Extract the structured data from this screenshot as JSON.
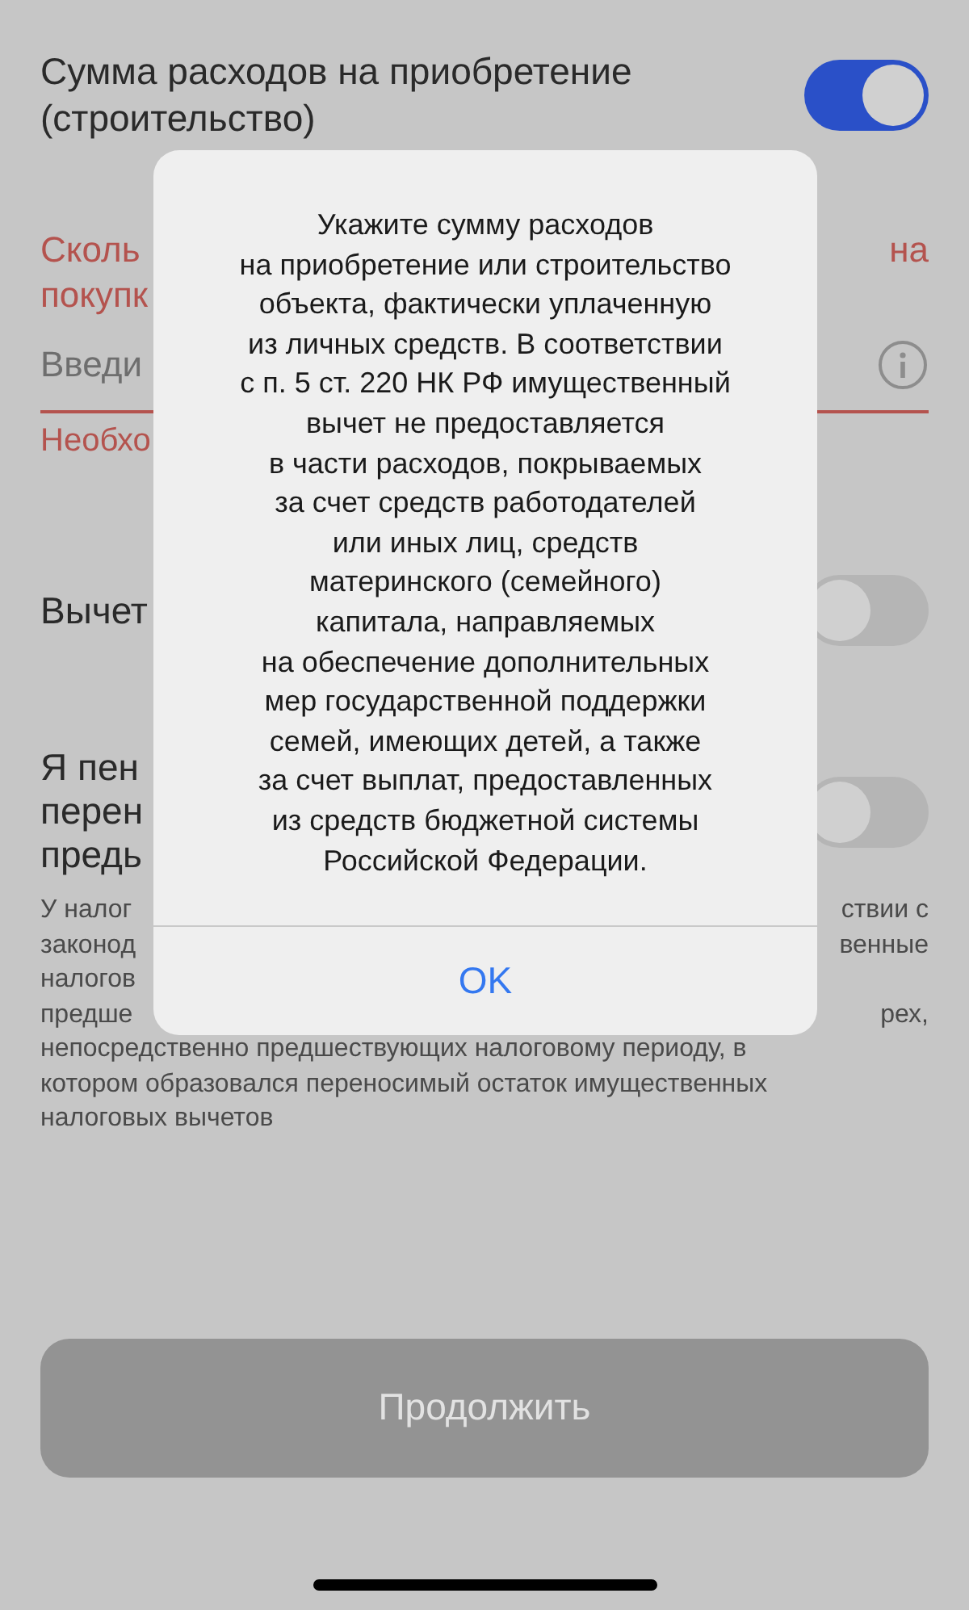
{
  "title_row": {
    "label": "Сумма расходов на приобретение (строительство)",
    "on": true
  },
  "question": {
    "left": [
      "Сколь",
      "покупк"
    ],
    "right": [
      "на"
    ]
  },
  "amount_field": {
    "placeholder": "Введи"
  },
  "error": {
    "left": "Необхо"
  },
  "deduction_row": {
    "label": "Вычет",
    "on": false
  },
  "transfer_row": {
    "lines": [
      "Я пен",
      "перен",
      "предь"
    ],
    "on": false
  },
  "note": {
    "partial": [
      {
        "left": "У налог",
        "right": "ствии с"
      },
      {
        "left": "законод",
        "right": "венные"
      },
      {
        "left": "налогов"
      },
      {
        "left": "предше",
        "right": "рех,"
      }
    ],
    "lines": [
      "непосредственно предшествующих налоговому периоду, в",
      "котором образовался переносимый остаток имущественных",
      "налоговых вычетов"
    ]
  },
  "continue_button": {
    "label": "Продолжить",
    "disabled": true
  },
  "alert": {
    "message": "Укажите сумму расходов\nна приобретение или строительство\nобъекта, фактически уплаченную\nиз личных средств. В соответствии\nс п. 5 ст. 220 НК РФ имущественный\nвычет не предоставляется\nв части расходов, покрываемых\nза счет средств работодателей\nили иных лиц, средств\nматеринского (семейного)\nкапитала, направляемых\nна обеспечение дополнительных\nмер государственной поддержки\nсемей, имеющих детей, а также\nза счет выплат, предоставленных\nиз средств бюджетной системы\nРоссийской Федерации.",
    "ok": "OK"
  }
}
